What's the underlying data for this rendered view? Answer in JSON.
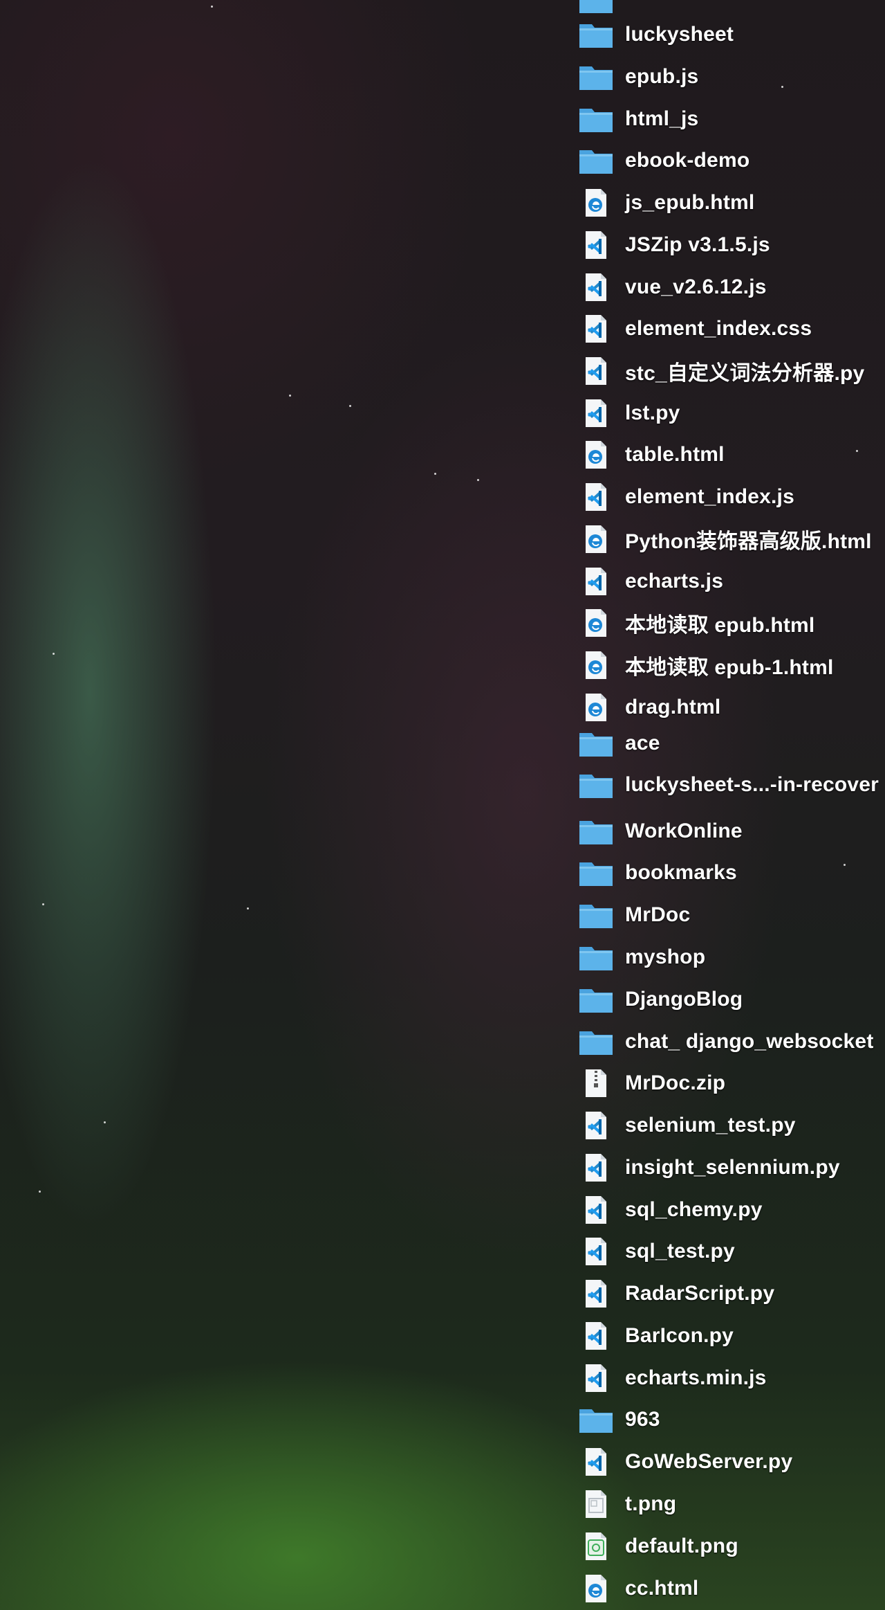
{
  "desktop": {
    "items": [
      {
        "label": "",
        "type": "folder"
      },
      {
        "label": "luckysheet",
        "type": "folder"
      },
      {
        "label": "epub.js",
        "type": "folder"
      },
      {
        "label": "html_js",
        "type": "folder"
      },
      {
        "label": "ebook-demo",
        "type": "folder"
      },
      {
        "label": "js_epub.html",
        "type": "html"
      },
      {
        "label": "JSZip v3.1.5.js",
        "type": "code"
      },
      {
        "label": "vue_v2.6.12.js",
        "type": "code"
      },
      {
        "label": "element_index.css",
        "type": "code"
      },
      {
        "label": "stc_自定义词法分析器.py",
        "type": "code"
      },
      {
        "label": "lst.py",
        "type": "code"
      },
      {
        "label": "table.html",
        "type": "html"
      },
      {
        "label": "element_index.js",
        "type": "code"
      },
      {
        "label": "Python装饰器高级版.html",
        "type": "html"
      },
      {
        "label": "echarts.js",
        "type": "code"
      },
      {
        "label": "本地读取 epub.html",
        "type": "html"
      },
      {
        "label": "本地读取 epub-1.html",
        "type": "html"
      },
      {
        "label": "drag.html",
        "type": "html"
      },
      {
        "label": "ace",
        "type": "folder"
      },
      {
        "label": "luckysheet-s...-in-recover",
        "type": "folder"
      },
      {
        "label": "WorkOnline",
        "type": "folder"
      },
      {
        "label": "bookmarks",
        "type": "folder"
      },
      {
        "label": "MrDoc",
        "type": "folder"
      },
      {
        "label": "myshop",
        "type": "folder"
      },
      {
        "label": "DjangoBlog",
        "type": "folder"
      },
      {
        "label": "chat_ django_websocket",
        "type": "folder"
      },
      {
        "label": "MrDoc.zip",
        "type": "zip"
      },
      {
        "label": "selenium_test.py",
        "type": "code"
      },
      {
        "label": "insight_selennium.py",
        "type": "code"
      },
      {
        "label": "sql_chemy.py",
        "type": "code"
      },
      {
        "label": "sql_test.py",
        "type": "code"
      },
      {
        "label": "RadarScript.py",
        "type": "code"
      },
      {
        "label": "BarIcon.py",
        "type": "code"
      },
      {
        "label": "echarts.min.js",
        "type": "code"
      },
      {
        "label": "963",
        "type": "folder"
      },
      {
        "label": "GoWebServer.py",
        "type": "code"
      },
      {
        "label": "t.png",
        "type": "image"
      },
      {
        "label": "default.png",
        "type": "image-green"
      },
      {
        "label": "cc.html",
        "type": "html"
      }
    ]
  }
}
